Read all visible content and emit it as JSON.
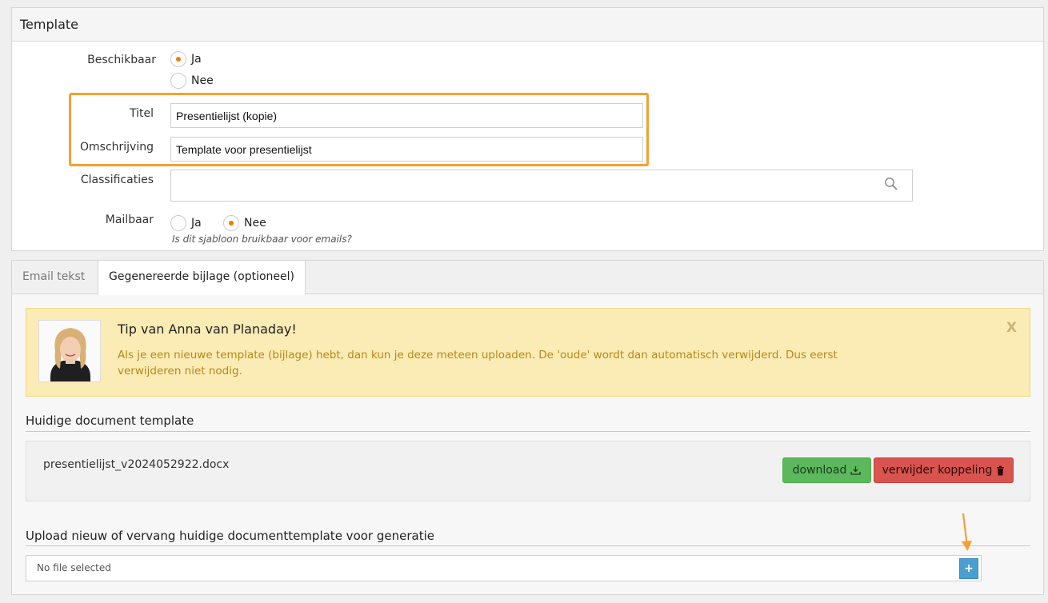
{
  "template_panel": {
    "title": "Template",
    "beschikbaar": {
      "label": "Beschikbaar",
      "options": [
        "Ja",
        "Nee"
      ],
      "selected": "Ja"
    },
    "titel": {
      "label": "Titel",
      "value": "Presentielijst (kopie)"
    },
    "omschrijving": {
      "label": "Omschrijving",
      "value": "Template voor presentielijst"
    },
    "classificaties": {
      "label": "Classificaties",
      "value": ""
    },
    "mailbaar": {
      "label": "Mailbaar",
      "options": [
        "Ja",
        "Nee"
      ],
      "selected": "Nee",
      "hint": "Is dit sjabloon bruikbaar voor emails?"
    }
  },
  "tabs": [
    {
      "label": "Email tekst",
      "active": false
    },
    {
      "label": "Gegenereerde bijlage (optioneel)",
      "active": true
    }
  ],
  "tip": {
    "title": "Tip van Anna van Planaday!",
    "text": "Als je een nieuwe template (bijlage) hebt, dan kun je deze meteen uploaden. De 'oude' wordt dan automatisch verwijderd. Dus eerst verwijderen niet nodig.",
    "close": "X"
  },
  "current_doc": {
    "heading": "Huidige document template",
    "filename": "presentielijst_v2024052922.docx",
    "download_label": "download",
    "remove_label": "verwijder koppeling"
  },
  "upload": {
    "heading": "Upload nieuw of vervang huidige documenttemplate voor generatie",
    "file_status": "No file selected",
    "add_label": "+"
  },
  "colors": {
    "accent": "#f07d00",
    "highlight": "#f5a033",
    "green": "#5cb85c",
    "red": "#d9534f",
    "blue": "#4a9fd0"
  }
}
